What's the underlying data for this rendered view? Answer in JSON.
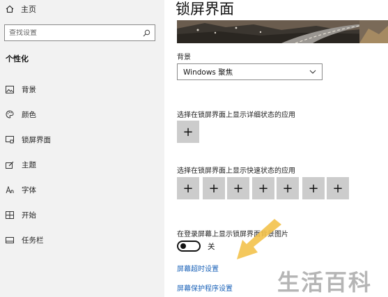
{
  "sidebar": {
    "home_label": "主页",
    "search_placeholder": "查找设置",
    "section_title": "个性化",
    "items": [
      {
        "label": "背景",
        "icon": "image-icon"
      },
      {
        "label": "颜色",
        "icon": "palette-icon"
      },
      {
        "label": "锁屏界面",
        "icon": "lock-screen-icon"
      },
      {
        "label": "主题",
        "icon": "theme-icon"
      },
      {
        "label": "字体",
        "icon": "font-icon"
      },
      {
        "label": "开始",
        "icon": "start-icon"
      },
      {
        "label": "任务栏",
        "icon": "taskbar-icon"
      }
    ]
  },
  "main": {
    "title": "锁屏界面",
    "background_label": "背景",
    "background_value": "Windows 聚焦",
    "detailed_status_label": "选择在锁屏界面上显示详细状态的应用",
    "quick_status_label": "选择在锁屏界面上显示快速状态的应用",
    "plus_symbol": "+",
    "signin_bg_label": "在登录屏幕上显示锁屏界面背景图片",
    "toggle_state": "关",
    "toggle_on": false,
    "link_timeout": "屏幕超时设置",
    "link_screensaver": "屏幕保护程序设置"
  },
  "watermark": "生活百科",
  "colors": {
    "sidebar_bg": "#f2f2f2",
    "link": "#1a62b8",
    "tile": "#cccccc",
    "arrow": "#f3c24b"
  }
}
